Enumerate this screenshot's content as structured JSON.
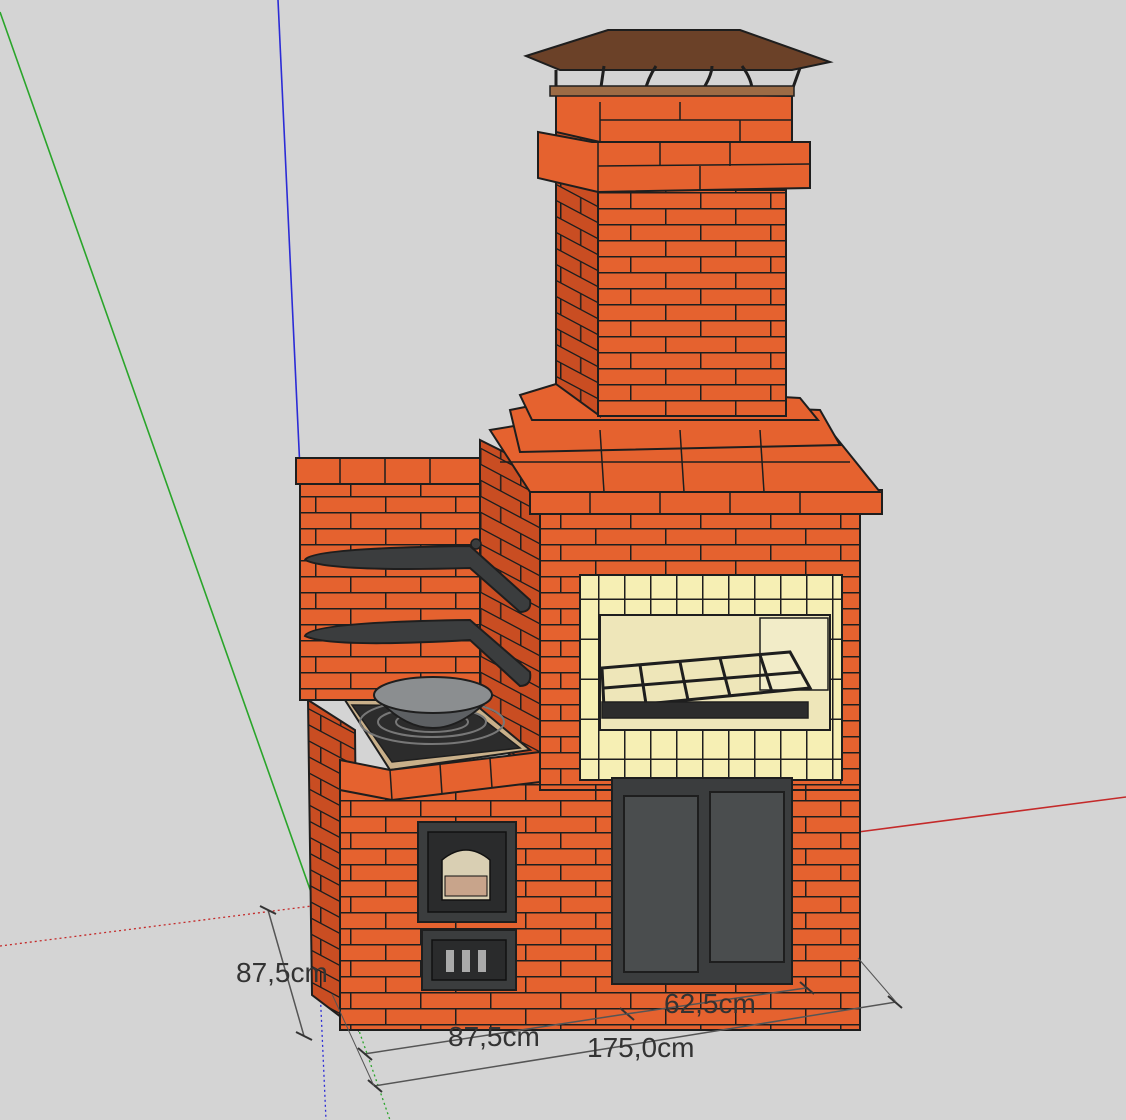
{
  "dimensions": {
    "depth": "87,5cm",
    "left_width": "87,5cm",
    "right_width": "62,5cm",
    "total_width": "175,0cm"
  },
  "colors": {
    "background": "#d4d4d4",
    "brick": "#e5622f",
    "brick_shade": "#c94d22",
    "mortar": "#1e1e1e",
    "fireclay": "#f6efb4",
    "metal": "#3b3d3e",
    "roof": "#6b4128",
    "axis_green": "#2aa52a",
    "axis_blue": "#2b2bd6",
    "axis_red": "#c42a2a"
  },
  "icons": [
    "wok-icon",
    "oven-door-icon",
    "grill-grate-icon",
    "chimney-cap-icon",
    "ash-door-icon"
  ]
}
